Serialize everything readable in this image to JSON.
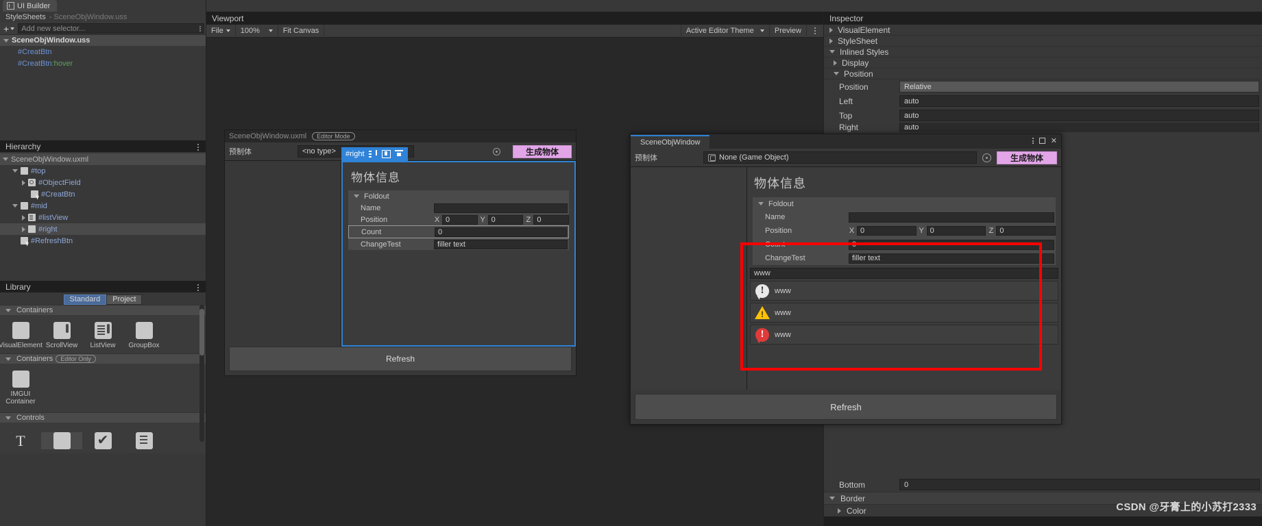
{
  "app": {
    "tab_label": "UI Builder",
    "tab_icon": "window-icon"
  },
  "stylesheets": {
    "header": "StyleSheets",
    "header_sub": "- SceneObjWindow.uss",
    "add_button": "+",
    "selector_placeholder": "Add new selector...",
    "root": "SceneObjWindow.uss",
    "selectors": [
      {
        "label": "#CreatBtn",
        "color": "#6f93d6"
      },
      {
        "label": "#CreatBtn",
        "pseudo": ":hover",
        "color": "#5fa05f"
      }
    ]
  },
  "hierarchy": {
    "header": "Hierarchy",
    "items": [
      {
        "label": "SceneObjWindow.uxml",
        "depth": 0,
        "icon": "none",
        "twisty": "down",
        "root": true
      },
      {
        "label": "#top",
        "depth": 1,
        "icon": "visual-element-icon",
        "twisty": "down"
      },
      {
        "label": "#ObjectField",
        "depth": 2,
        "icon": "object-field-icon",
        "twisty": "right"
      },
      {
        "label": "#CreatBtn",
        "depth": 2,
        "icon": "button-icon",
        "twisty": "none"
      },
      {
        "label": "#mid",
        "depth": 1,
        "icon": "visual-element-icon",
        "twisty": "down"
      },
      {
        "label": "#listView",
        "depth": 2,
        "icon": "list-view-icon",
        "twisty": "right"
      },
      {
        "label": "#right",
        "depth": 2,
        "icon": "visual-element-icon",
        "twisty": "right",
        "selected": true
      },
      {
        "label": "#RefreshBtn",
        "depth": 1,
        "icon": "button-icon",
        "twisty": "none"
      }
    ]
  },
  "library": {
    "header": "Library",
    "tabs": [
      {
        "label": "Standard",
        "active": true
      },
      {
        "label": "Project",
        "active": false
      }
    ],
    "sections": [
      {
        "title": "Containers",
        "badge": null,
        "items": [
          {
            "label": "VisualElement",
            "icon": "visual-element-icon"
          },
          {
            "label": "ScrollView",
            "icon": "scroll-view-icon"
          },
          {
            "label": "ListView",
            "icon": "list-view-icon"
          },
          {
            "label": "GroupBox",
            "icon": "group-box-icon"
          }
        ]
      },
      {
        "title": "Containers",
        "badge": "Editor Only",
        "items": [
          {
            "label": "IMGUI Container",
            "icon": "imgui-container-icon"
          }
        ]
      },
      {
        "title": "Controls",
        "badge": null,
        "items": [
          {
            "label": "",
            "icon": "label-text-icon"
          },
          {
            "label": "",
            "icon": "button-icon",
            "highlighted": true
          },
          {
            "label": "",
            "icon": "toggle-check-icon"
          },
          {
            "label": "",
            "icon": "dropdown-icon"
          }
        ]
      }
    ]
  },
  "viewport": {
    "title": "Viewport",
    "toolbar": {
      "file_menu": "File",
      "zoom": "100%",
      "fit_canvas": "Fit Canvas",
      "theme": "Active Editor Theme",
      "preview": "Preview"
    },
    "canvas": {
      "document_name": "SceneObjWindow.uxml",
      "mode_badge": "Editor Mode",
      "prefab_label": "预制体",
      "object_field_value": "<no type>",
      "generate_button": "生成物体",
      "selected_element_badge": "#right",
      "badge_icons": [
        "flex-direction-icon",
        "align-icon",
        "justify-icon"
      ],
      "refresh_button": "Refresh",
      "object_info": {
        "title": "物体信息",
        "foldout_label": "Foldout",
        "rows": [
          {
            "label": "Name",
            "type": "text",
            "value": ""
          },
          {
            "label": "Position",
            "type": "vector3",
            "x": "0",
            "y": "0",
            "z": "0",
            "axes": [
              "X",
              "Y",
              "Z"
            ]
          },
          {
            "label": "Count",
            "type": "text",
            "value": "0",
            "outlined": true
          },
          {
            "label": "ChangeTest",
            "type": "text",
            "value": "filler text"
          }
        ]
      }
    }
  },
  "inspector": {
    "title": "Inspector",
    "sections": [
      {
        "label": "VisualElement",
        "twisty": "right"
      },
      {
        "label": "StyleSheet",
        "twisty": "right"
      },
      {
        "label": "Inlined Styles",
        "twisty": "down"
      },
      {
        "label": "Display",
        "twisty": "right",
        "indent": true
      },
      {
        "label": "Position",
        "twisty": "down",
        "indent": true
      }
    ],
    "properties": [
      {
        "label": "Position",
        "value": "Relative",
        "type": "dropdown"
      },
      {
        "label": "Left",
        "value": "auto",
        "type": "text"
      },
      {
        "label": "Top",
        "value": "auto",
        "type": "text"
      },
      {
        "label": "Right",
        "value": "auto",
        "type": "text"
      }
    ],
    "lower_properties": [
      {
        "label": "Bottom",
        "value": "0",
        "type": "text"
      }
    ],
    "lower_sections": [
      {
        "label": "Border",
        "twisty": "down"
      },
      {
        "label": "Color",
        "twisty": "right",
        "indent": true
      }
    ]
  },
  "floating_window": {
    "tab_label": "SceneObjWindow",
    "prefab_label": "预制体",
    "object_field_value": "None (Game Object)",
    "object_field_icon": "game-object-icon",
    "generate_button": "生成物体",
    "refresh_button": "Refresh",
    "object_info": {
      "title": "物体信息",
      "foldout_label": "Foldout",
      "rows": [
        {
          "label": "Name",
          "type": "text",
          "value": ""
        },
        {
          "label": "Position",
          "type": "vector3",
          "x": "0",
          "y": "0",
          "z": "0",
          "axes": [
            "X",
            "Y",
            "Z"
          ]
        },
        {
          "label": "Count",
          "type": "text",
          "value": "0"
        },
        {
          "label": "ChangeTest",
          "type": "text",
          "value": "filler text"
        }
      ]
    },
    "help_boxes": {
      "plain_field": "www",
      "items": [
        {
          "icon": "info-icon",
          "text": "www",
          "color": "#e9e9e9"
        },
        {
          "icon": "warning-icon",
          "text": "www",
          "color": "#ffc107"
        },
        {
          "icon": "error-icon",
          "text": "www",
          "color": "#e03a3a"
        }
      ]
    }
  },
  "annotation": {
    "highlight_color": "#ff0000"
  },
  "watermark": "CSDN @牙膏上的小苏打2333"
}
